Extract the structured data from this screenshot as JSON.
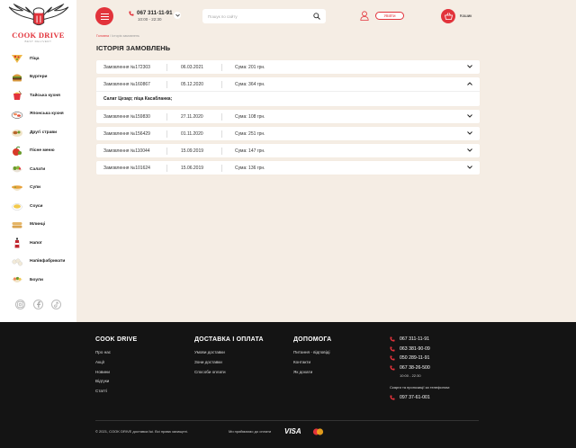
{
  "brand": {
    "name": "COOK DRIVE",
    "tagline": "BEST DELIVERY"
  },
  "categories": [
    {
      "label": "Піца",
      "icon": "pizza-icon"
    },
    {
      "label": "Бургери",
      "icon": "burger-icon"
    },
    {
      "label": "Тайська кухня",
      "icon": "thai-food-icon"
    },
    {
      "label": "Японська кухня",
      "icon": "sushi-icon"
    },
    {
      "label": "Другі страви",
      "icon": "main-course-icon"
    },
    {
      "label": "Пісне меню",
      "icon": "lean-menu-icon"
    },
    {
      "label": "Салати",
      "icon": "salad-icon"
    },
    {
      "label": "Супи",
      "icon": "soup-icon"
    },
    {
      "label": "Соуси",
      "icon": "sauce-icon"
    },
    {
      "label": "Млинці",
      "icon": "pancakes-icon"
    },
    {
      "label": "Напої",
      "icon": "drink-icon"
    },
    {
      "label": "Напівфабрикати",
      "icon": "semi-finished-icon"
    },
    {
      "label": "Боули",
      "icon": "bowl-icon"
    }
  ],
  "header": {
    "phone": "067 311-11-91",
    "hours": "10:00 - 22:30",
    "search_placeholder": "Пошук по сайту",
    "login_label": "Увійти",
    "cart_label": "Кошик"
  },
  "breadcrumb": {
    "home": "Головна",
    "separator": "/",
    "current": "Історія замовлень"
  },
  "page_title": "ІСТОРІЯ ЗАМОВЛЕНЬ",
  "orders": [
    {
      "id": "Замовлення №172303",
      "date": "06.03.2021",
      "sum": "Сума: 201 грн.",
      "expanded": false
    },
    {
      "id": "Замовлення №160867",
      "date": "05.12.2020",
      "sum": "Сума: 364 грн.",
      "expanded": true,
      "details": "Салат Цезар; піца Касабланка;"
    },
    {
      "id": "Замовлення №159830",
      "date": "27.11.2020",
      "sum": "Сума: 108 грн.",
      "expanded": false
    },
    {
      "id": "Замовлення №156429",
      "date": "01.11.2020",
      "sum": "Сума: 251 грн.",
      "expanded": false
    },
    {
      "id": "Замовлення №110044",
      "date": "15.09.2019",
      "sum": "Сума: 147 грн.",
      "expanded": false
    },
    {
      "id": "Замовлення №101624",
      "date": "15.06.2019",
      "sum": "Сума: 136 грн.",
      "expanded": false
    }
  ],
  "footer": {
    "col1": {
      "title": "COOK DRIVE",
      "links": [
        "Про нас",
        "Акції",
        "Новини",
        "Відгуки",
        "Статті"
      ]
    },
    "col2": {
      "title": "ДОСТАВКА І ОПЛАТА",
      "links": [
        "Умови доставки",
        "Зони доставки",
        "Способи оплати"
      ]
    },
    "col3": {
      "title": "ДОПОМОГА",
      "links": [
        "Питання - відповіді",
        "Контакти",
        "Як дохати"
      ]
    },
    "phones": [
      "067 311-11-91",
      "063 381-90-09",
      "050 289-11-91",
      "067 38-26-500"
    ],
    "hours": "10:00 - 22:30",
    "complaint_note": "Скарги та пропозиції за телефоном:",
    "complaint_phone": "097 37-61-001",
    "copyright": "© 2021, COOK DRIVE доставка їжі.  Всі права захищені.",
    "pay_label": "Ми приймаємо до оплати",
    "visa": "VISA"
  },
  "colors": {
    "accent": "#e2333b",
    "background": "#f5ede4",
    "footer": "#141414"
  }
}
